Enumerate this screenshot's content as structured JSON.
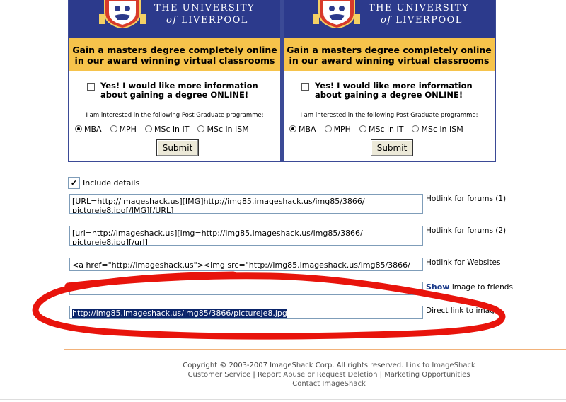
{
  "ads": [
    {
      "university_line1": "THE UNIVERSITY",
      "university_of": "of",
      "university_line2": "LIVERPOOL",
      "headline_1": "Gain a masters degree completely online",
      "headline_2": "in our award winning virtual classrooms",
      "yes_1": "Yes! I would like more information",
      "yes_2": "about gaining a degree ONLINE!",
      "interest": "I am interested in the following Post Graduate programme:",
      "options": [
        "MBA",
        "MPH",
        "MSc in IT",
        "MSc in ISM"
      ],
      "selected": "MBA",
      "submit": "Submit"
    },
    {
      "university_line1": "THE UNIVERSITY",
      "university_of": "of",
      "university_line2": "LIVERPOOL",
      "headline_1": "Gain a masters degree completely online",
      "headline_2": "in our award winning virtual classrooms",
      "yes_1": "Yes! I would like more information",
      "yes_2": "about gaining a degree ONLINE!",
      "interest": "I am interested in the following Post Graduate programme:",
      "options": [
        "MBA",
        "MPH",
        "MSc in IT",
        "MSc in ISM"
      ],
      "selected": "MBA",
      "submit": "Submit"
    }
  ],
  "include_details": {
    "label": "Include details",
    "checked": true,
    "check_glyph": "✔"
  },
  "links": [
    {
      "value_line1": "[URL=http://imageshack.us][IMG]http://img85.imageshack.us/img85/3866/",
      "value_line2": "pictureje8.jpg[/IMG][/URL]",
      "label": "Hotlink for forums (1)"
    },
    {
      "value_line1": "[url=http://imageshack.us][img=http://img85.imageshack.us/img85/3866/",
      "value_line2": "pictureje8.jpg][/url]",
      "label": "Hotlink for forums (2)"
    },
    {
      "value_line1": "<a href=\"http://imageshack.us\"><img src=\"http://img85.imageshack.us/img85/3866/",
      "label": "Hotlink for Websites"
    },
    {
      "value_line1": "",
      "label_bold": "Show",
      "label": "image to friends"
    },
    {
      "value_line1": "http://img85.imageshack.us/img85/3866/pictureje8.jpg",
      "label": "Direct link to image"
    }
  ],
  "footer": {
    "copyright_prefix": "Copyright ",
    "copyright_symbol": "©",
    "copyright_text": " 2003-2007 ImageShack Corp. All rights reserved.",
    "link_to": "Link to ImageShack",
    "customer_service": "Customer Service",
    "report_abuse": "Report Abuse or Request Deletion",
    "marketing": "Marketing Opportunities",
    "contact": "Contact ImageShack"
  },
  "colors": {
    "banner": "#2c3a8c",
    "gold": "#f6c34b",
    "annotation": "#e8140c"
  }
}
